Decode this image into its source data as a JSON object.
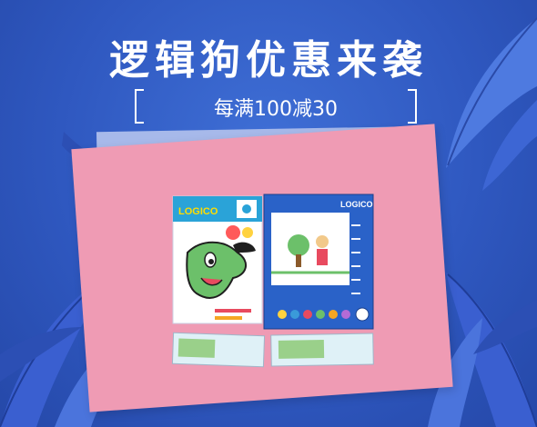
{
  "banner": {
    "headline": "逻辑狗优惠来袭",
    "promo": "每满100减30"
  },
  "product": {
    "book_logo": "LOGICO",
    "board_logo": "LOGICO"
  },
  "colors": {
    "background": "#2f58c0",
    "card_pink": "#ef9bb4",
    "card_lavender": "#a7b9ea",
    "leaf_blue": "#3a5fd0",
    "text": "#ffffff"
  }
}
